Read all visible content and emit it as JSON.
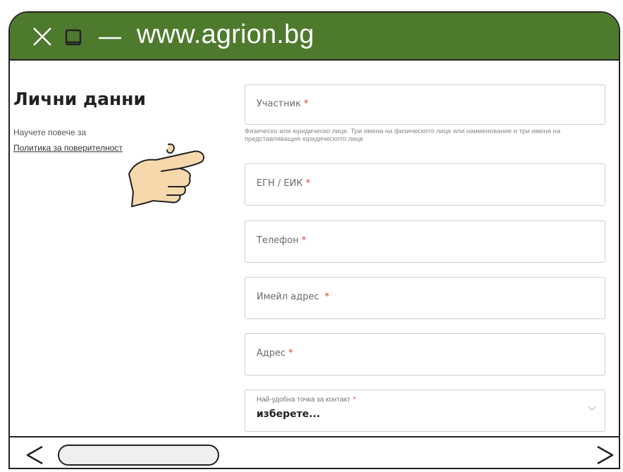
{
  "browser": {
    "url": "www.agrion.bg",
    "close_icon": "close-icon",
    "maximize_icon": "maximize-icon",
    "minimize_icon": "minimize-icon",
    "back_icon": "chevron-left-icon",
    "forward_icon": "chevron-right-icon"
  },
  "left": {
    "title": "Лични данни",
    "note": "Научете повече за",
    "link": "Политика за поверителност"
  },
  "form": {
    "required_mark": "*",
    "participant": {
      "label": "Участник",
      "helper": "Физическо или юридическо лице. Три имена на физическото лице или наименование и три имена на представляващия юридическото лице"
    },
    "egn": {
      "label": "ЕГН / ЕИК"
    },
    "phone": {
      "label": "Телефон"
    },
    "email": {
      "label": "Имейл адрес"
    },
    "address": {
      "label": "Адрес"
    },
    "contact": {
      "label": "Най-удобна точка за контакт",
      "value": "изберете..."
    }
  },
  "colors": {
    "titlebar": "#4e7a2e",
    "required": "#e23b2b",
    "hand": "#f7d7ac"
  }
}
